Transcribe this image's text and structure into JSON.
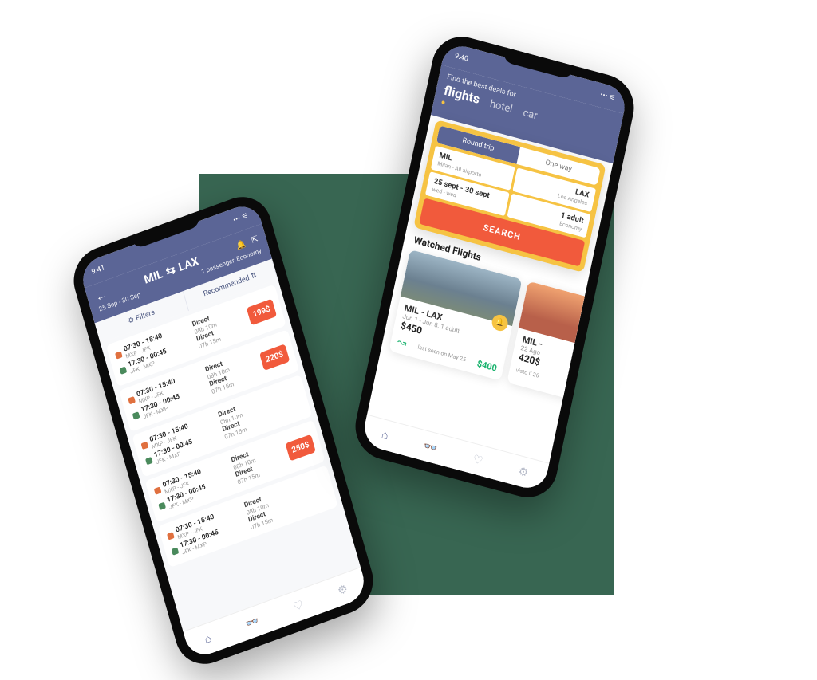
{
  "colors": {
    "primary": "#5b6596",
    "accent": "#f15a3c",
    "yellow": "#f6c343",
    "green": "#1db470",
    "bgsquare": "#386652"
  },
  "phone1": {
    "status_time": "9:41",
    "route_from": "MIL",
    "route_to": "LAX",
    "dates": "25 Sep - 30 Sep",
    "pax": "1 passenger, Economy",
    "filters_label": "Filters",
    "sort_label": "Recommended",
    "results": [
      {
        "out_t": "07:30 - 15:40",
        "out_r": "MXP - JFK",
        "ret_t": "17:30 - 00:45",
        "ret_r": "JFK - MXP",
        "dir1": "Direct",
        "dur1": "08h 10m",
        "dir2": "Direct",
        "dur2": "07h 15m",
        "price": "199$"
      },
      {
        "out_t": "07:30 - 15:40",
        "out_r": "MXP - JFK",
        "ret_t": "17:30 - 00:45",
        "ret_r": "JFK - MXP",
        "dir1": "Direct",
        "dur1": "08h 10m",
        "dir2": "Direct",
        "dur2": "07h 15m",
        "price": "220$"
      },
      {
        "out_t": "07:30 - 15:40",
        "out_r": "MXP - JFK",
        "ret_t": "17:30 - 00:45",
        "ret_r": "JFK - MXP",
        "dir1": "Direct",
        "dur1": "08h 10m",
        "dir2": "Direct",
        "dur2": "07h 15m",
        "price": ""
      },
      {
        "out_t": "07:30 - 15:40",
        "out_r": "MXP - JFK",
        "ret_t": "17:30 - 00:45",
        "ret_r": "JFK - MXP",
        "dir1": "Direct",
        "dur1": "08h 10m",
        "dir2": "Direct",
        "dur2": "07h 15m",
        "price": "250$"
      },
      {
        "out_t": "07:30 - 15:40",
        "out_r": "MXP - JFK",
        "ret_t": "17:30 - 00:45",
        "ret_r": "JFK - MXP",
        "dir1": "Direct",
        "dur1": "08h 10m",
        "dir2": "Direct",
        "dur2": "07h 15m",
        "price": ""
      }
    ]
  },
  "phone2": {
    "status_time": "9:40",
    "tagline": "Find the best deals for",
    "tab_flights": "flights",
    "tab_hotel": "hotel",
    "tab_car": "car",
    "trip_round": "Round trip",
    "trip_oneway": "One way",
    "from_code": "MIL",
    "from_sub": "Milan - All airports",
    "to_code": "LAX",
    "to_sub": "Los Angeles",
    "dates_main": "25 sept - 30 sept",
    "dates_sub": "wed - wed",
    "pax_main": "1 adult",
    "pax_sub": "Economy",
    "search_btn": "SEARCH",
    "watched_h": "Watched Flights",
    "watched": [
      {
        "route": "MIL - LAX",
        "sub": "Jun 1 - Jun 8, 1 adult",
        "price": "$450",
        "low": "$400",
        "seen": "last seen on  May 25"
      },
      {
        "route": "MIL -",
        "sub": "22 Ago",
        "price": "420$",
        "low": "",
        "seen": "visto il 26"
      }
    ]
  }
}
